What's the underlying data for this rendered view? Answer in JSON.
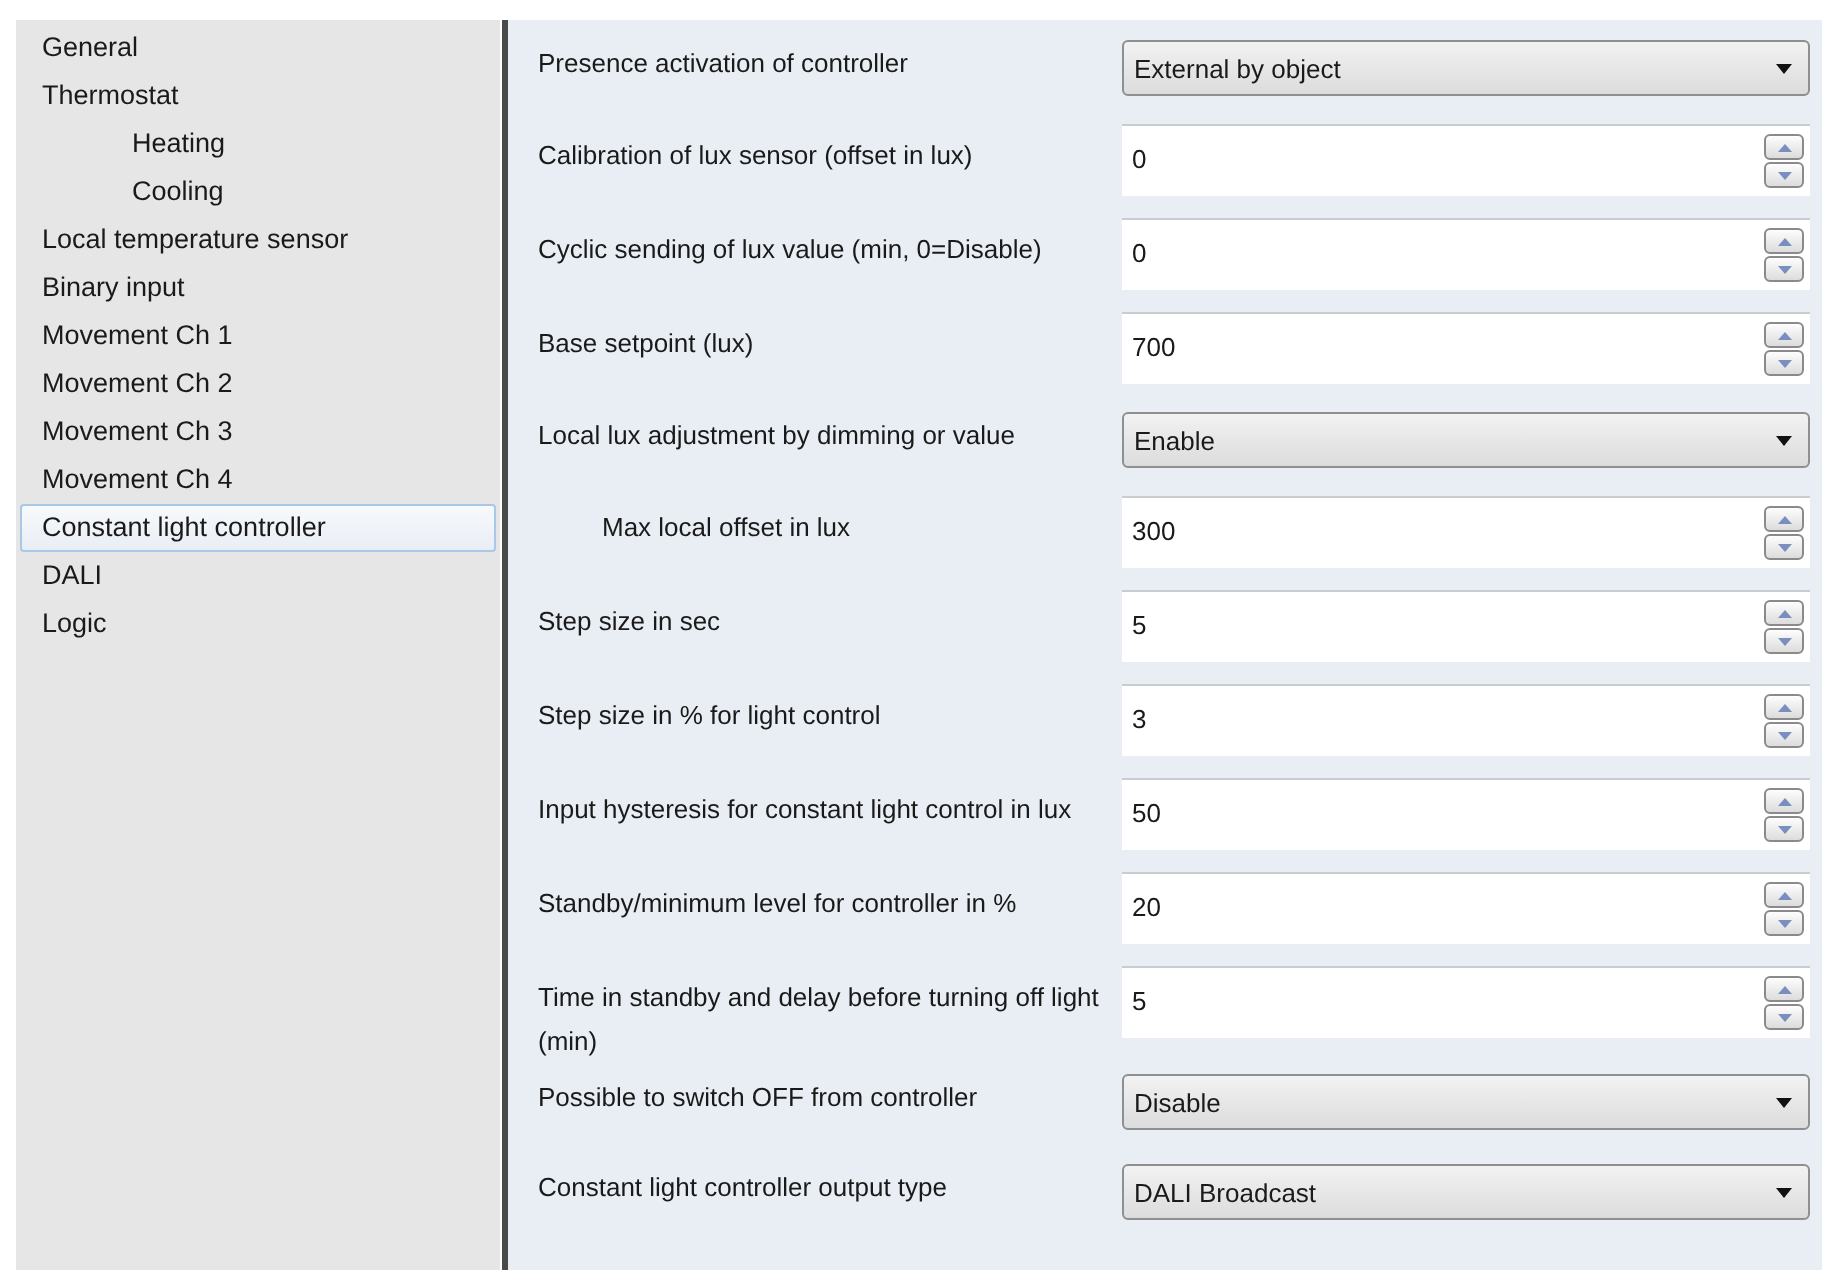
{
  "sidebar": {
    "items": [
      {
        "label": "General",
        "selected": false
      },
      {
        "label": "Thermostat",
        "selected": false,
        "children": [
          {
            "label": "Heating",
            "selected": false
          },
          {
            "label": "Cooling",
            "selected": false
          }
        ]
      },
      {
        "label": "Local temperature sensor",
        "selected": false
      },
      {
        "label": "Binary input",
        "selected": false
      },
      {
        "label": "Movement Ch 1",
        "selected": false
      },
      {
        "label": "Movement Ch 2",
        "selected": false
      },
      {
        "label": "Movement Ch 3",
        "selected": false
      },
      {
        "label": "Movement Ch 4",
        "selected": false
      },
      {
        "label": "Constant light controller",
        "selected": true
      },
      {
        "label": "DALI",
        "selected": false
      },
      {
        "label": "Logic",
        "selected": false
      }
    ]
  },
  "parameters": [
    {
      "label": "Presence activation of controller",
      "kind": "dropdown",
      "value": "External by object"
    },
    {
      "label": "Calibration of lux sensor (offset in lux)",
      "kind": "spin",
      "value": "0"
    },
    {
      "label": "Cyclic sending of lux value (min, 0=Disable)",
      "kind": "spin",
      "value": "0"
    },
    {
      "label": "Base setpoint (lux)",
      "kind": "spin",
      "value": "700"
    },
    {
      "label": "Local lux adjustment by dimming or value",
      "kind": "dropdown",
      "value": "Enable",
      "children": [
        {
          "label": "Max local offset in lux",
          "kind": "spin",
          "value": "300"
        }
      ]
    },
    {
      "label": "Step size in sec",
      "kind": "spin",
      "value": "5"
    },
    {
      "label": "Step size in % for light control",
      "kind": "spin",
      "value": "3"
    },
    {
      "label": "Input hysteresis for constant light control in lux",
      "kind": "spin",
      "value": "50"
    },
    {
      "label": "Standby/minimum level for controller in %",
      "kind": "spin",
      "value": "20"
    },
    {
      "label": "Time in standby and delay before turning off light (min)",
      "kind": "spin",
      "value": "5"
    },
    {
      "label": "Possible to switch OFF from controller",
      "kind": "dropdown",
      "value": "Disable"
    },
    {
      "label": "Constant light controller output type",
      "kind": "dropdown",
      "value": "DALI Broadcast"
    }
  ]
}
